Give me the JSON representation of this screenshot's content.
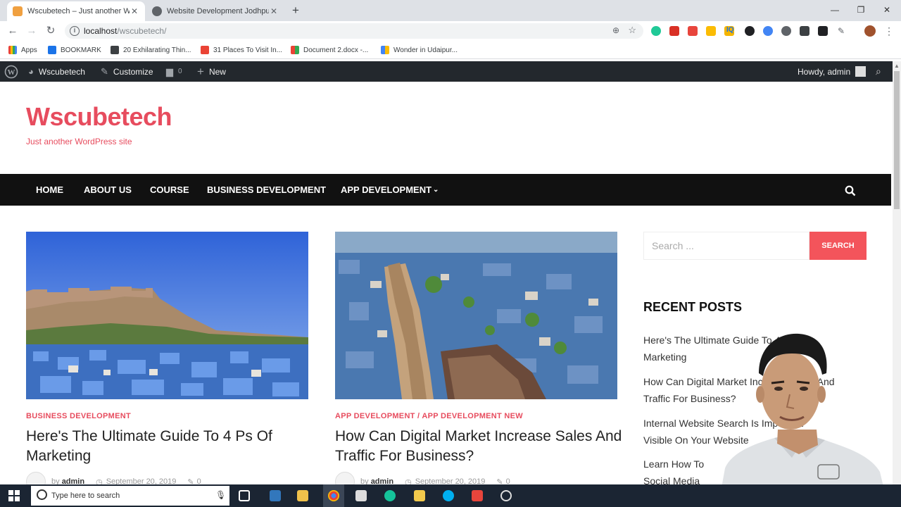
{
  "browser": {
    "tabs": [
      {
        "title": "Wscubetech – Just another Wor",
        "active": true
      },
      {
        "title": "Website Development Jodhpur",
        "active": false
      }
    ],
    "url_host": "localhost",
    "url_path": "/wscubetech/",
    "bookmarks": [
      "Apps",
      "BOOKMARK",
      "20 Exhilarating Thin...",
      "31 Places To Visit In...",
      "Document 2.docx -...",
      "Wonder in Udaipur..."
    ]
  },
  "adminbar": {
    "site": "Wscubetech",
    "customize": "Customize",
    "comments": "0",
    "new": "New",
    "howdy": "Howdy, admin"
  },
  "site": {
    "title": "Wscubetech",
    "tagline": "Just another WordPress site"
  },
  "nav": [
    "HOME",
    "ABOUT US",
    "COURSE",
    "BUSINESS DEVELOPMENT",
    "APP DEVELOPMENT"
  ],
  "posts": [
    {
      "category": "BUSINESS DEVELOPMENT",
      "title_line1": "Here's The Ultimate Guide To 4 Ps Of",
      "title_line2": "Marketing",
      "by": "by",
      "author": "admin",
      "date": "September 20, 2019",
      "comments": "0"
    },
    {
      "category": "APP DEVELOPMENT / APP DEVELOPMENT NEW",
      "title_line1": "How Can Digital Market Increase Sales And",
      "title_line2": "Traffic For Business?",
      "by": "by",
      "author": "admin",
      "date": "September 20, 2019",
      "comments": "0"
    }
  ],
  "sidebar": {
    "search_placeholder": "Search ...",
    "search_button": "SEARCH",
    "recent_title": "RECENT POSTS",
    "recent": [
      {
        "line1": "Here's The Ultimate Guide To 4 Ps Of",
        "line2": "Marketing"
      },
      {
        "line1": "How Can Digital Market Increase Sales And",
        "line2": "Traffic For Business?"
      },
      {
        "line1": "Internal Website Search Is Important",
        "line2": "Visible On Your Website"
      },
      {
        "line1": "Learn How To",
        "line2": "Social Media"
      }
    ]
  },
  "taskbar": {
    "search_placeholder": "Type here to search"
  },
  "colors": {
    "accent": "#e74c5e",
    "search_button": "#f3545b",
    "adminbar": "#23282d",
    "nav": "#111111"
  }
}
